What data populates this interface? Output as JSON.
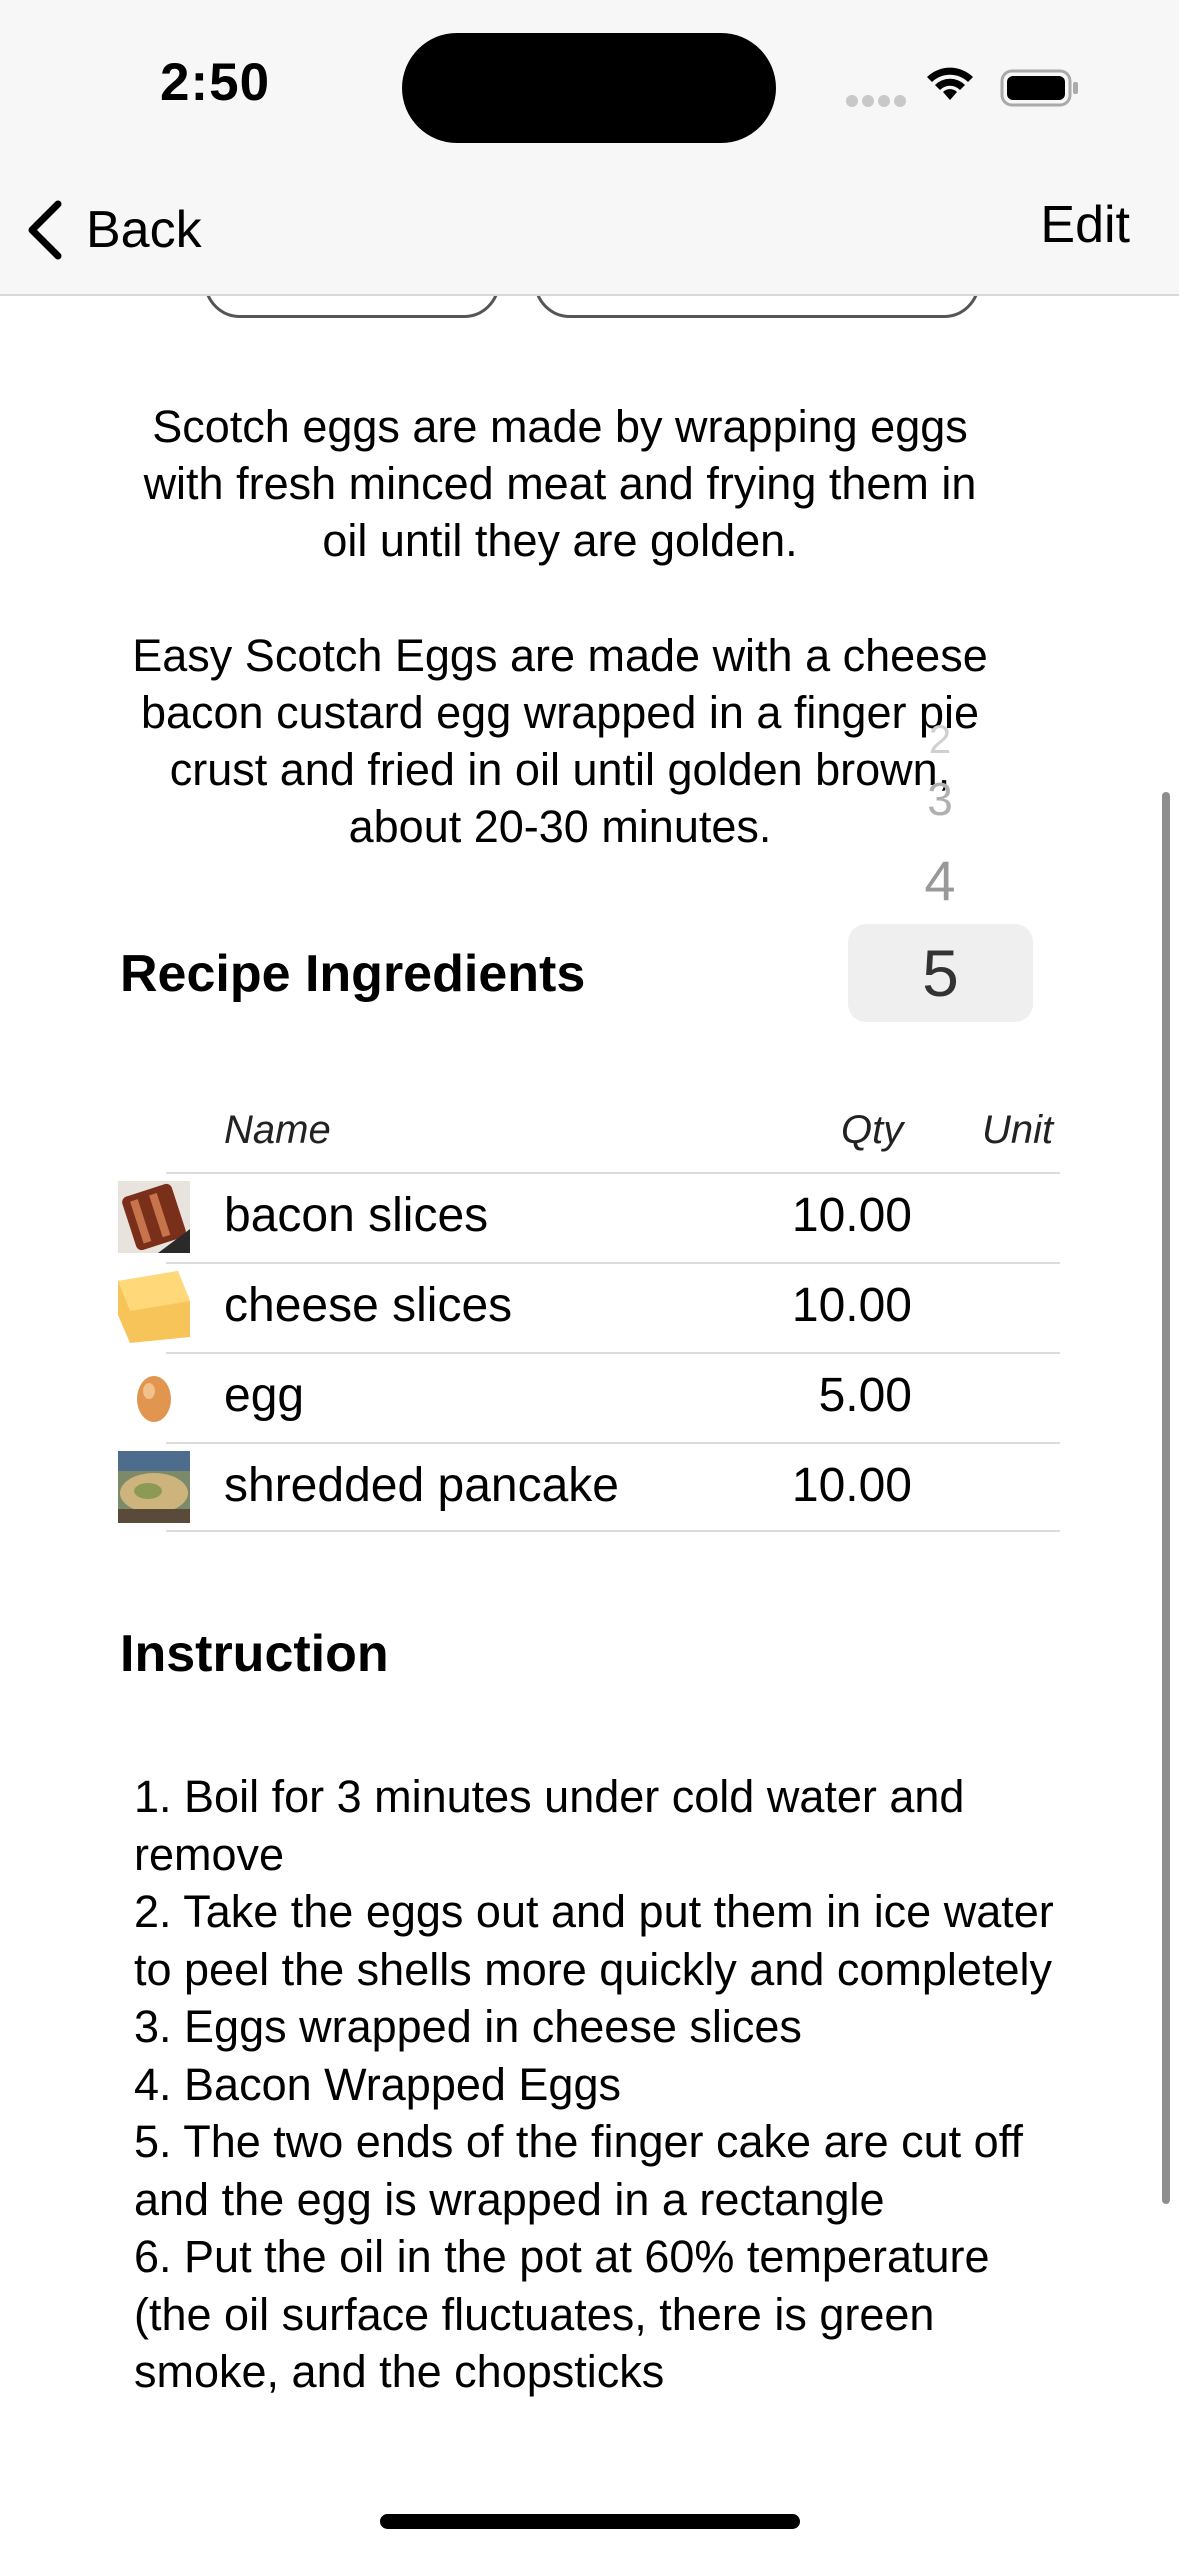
{
  "status_bar": {
    "time": "2:50"
  },
  "nav": {
    "back_label": "Back",
    "edit_label": "Edit"
  },
  "description": {
    "paragraph1": "Scotch eggs are made by wrapping eggs with fresh minced meat and frying them in oil until they are golden.",
    "paragraph2": "Easy Scotch Eggs are made with a cheese bacon custard egg wrapped in a finger pie crust and fried in oil until golden brown, about 20-30 minutes."
  },
  "servings_picker": {
    "options_above": [
      "2",
      "3",
      "4"
    ],
    "selected": "5"
  },
  "ingredients": {
    "title": "Recipe Ingredients",
    "columns": {
      "name": "Name",
      "qty": "Qty",
      "unit": "Unit"
    },
    "rows": [
      {
        "name": "bacon slices",
        "qty": "10.00",
        "unit": "",
        "icon": "bacon-thumbnail"
      },
      {
        "name": "cheese slices",
        "qty": "10.00",
        "unit": "",
        "icon": "cheese-thumbnail"
      },
      {
        "name": "egg",
        "qty": "5.00",
        "unit": "",
        "icon": "egg-thumbnail"
      },
      {
        "name": "shredded pancake",
        "qty": "10.00",
        "unit": "",
        "icon": "pancake-thumbnail"
      }
    ]
  },
  "instruction": {
    "title": "Instruction",
    "text": "1. Boil for 3 minutes under cold water and remove\n2. Take the eggs out and put them in ice water to peel the shells more quickly and completely\n3. Eggs wrapped in cheese slices\n4. Bacon Wrapped Eggs\n5. The two ends of the finger cake are cut off and the egg is wrapped in a rectangle\n6. Put the oil in the pot at 60% temperature (the oil surface fluctuates, there is green smoke, and the chopsticks"
  }
}
